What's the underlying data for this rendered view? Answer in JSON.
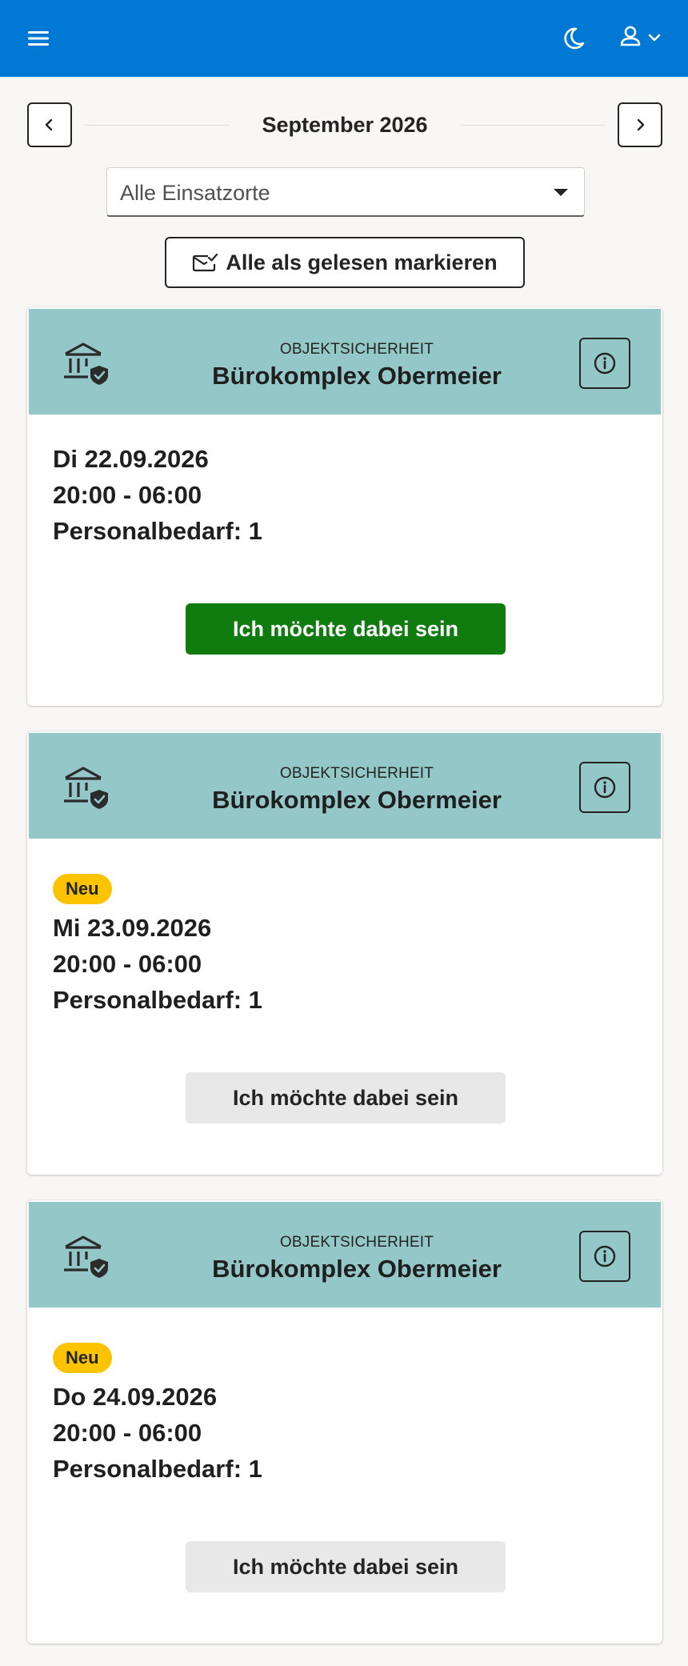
{
  "header": {
    "menu_icon": "hamburger-menu-icon",
    "theme_icon": "moon-icon",
    "user_icon": "person-icon",
    "background_color": "#0078d4"
  },
  "month_nav": {
    "label": "September 2026"
  },
  "location_filter": {
    "selected": "Alle Einsatzorte"
  },
  "mark_all_read": {
    "label": "Alle als gelesen markieren"
  },
  "cards": [
    {
      "category": "OBJEKTSICHERHEIT",
      "title": "Bürokomplex Obermeier",
      "badge": "",
      "date": "Di 22.09.2026",
      "time": "20:00 - 06:00",
      "staff": "Personalbedarf: 1",
      "button_label": "Ich möchte dabei sein",
      "button_state": "selected"
    },
    {
      "category": "OBJEKTSICHERHEIT",
      "title": "Bürokomplex Obermeier",
      "badge": "Neu",
      "date": "Mi 23.09.2026",
      "time": "20:00 - 06:00",
      "staff": "Personalbedarf: 1",
      "button_label": "Ich möchte dabei sein",
      "button_state": "default"
    },
    {
      "category": "OBJEKTSICHERHEIT",
      "title": "Bürokomplex Obermeier",
      "badge": "Neu",
      "date": "Do 24.09.2026",
      "time": "20:00 - 06:00",
      "staff": "Personalbedarf: 1",
      "button_label": "Ich möchte dabei sein",
      "button_state": "default"
    }
  ],
  "colors": {
    "card_header": "#94c8c8",
    "primary_button": "#107c10",
    "badge": "#fcc400"
  }
}
